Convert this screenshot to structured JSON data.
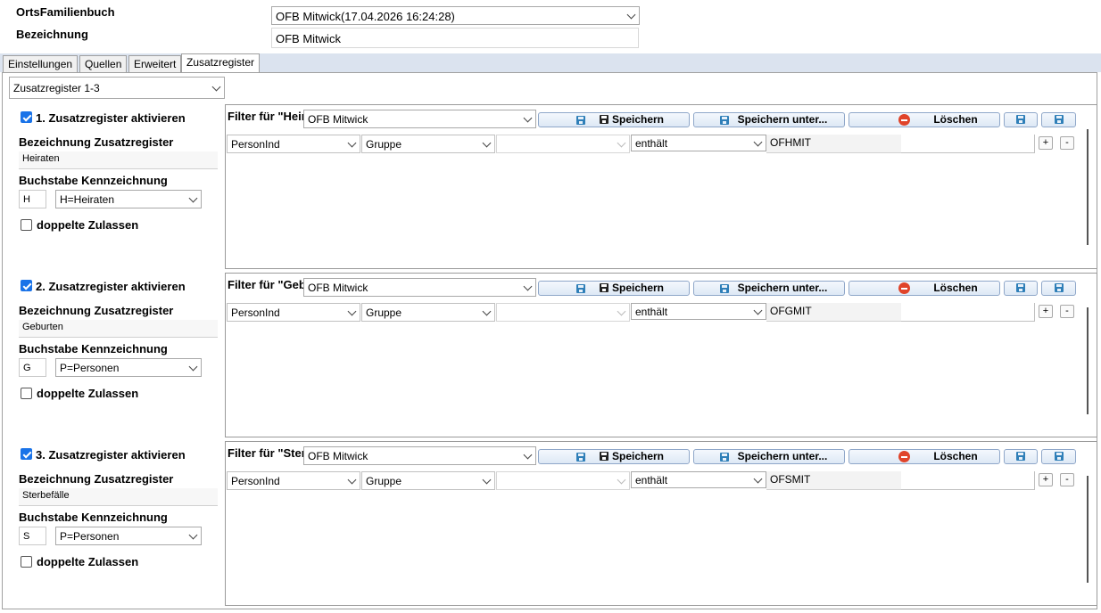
{
  "header": {
    "ofb_label": "OrtsFamilienbuch",
    "ofb_value": "OFB Mitwick(17.04.2026 16:24:28)",
    "bezeichnung_label": "Bezeichnung",
    "bezeichnung_value": "OFB Mitwick"
  },
  "tabs": [
    "Einstellungen",
    "Quellen",
    "Erweitert",
    "Zusatzregister"
  ],
  "active_tab": "Zusatzregister",
  "register_select": "Zusatzregister 1-3",
  "registers": [
    {
      "activate_label": "1. Zusatzregister aktivieren",
      "checked": true,
      "name_label": "Bezeichnung Zusatzregister",
      "name_value": "Heiraten",
      "letter_label": "Buchstabe Kennzeichnung",
      "letter_value": "H",
      "type_value": "H=Heiraten",
      "dup_label": "doppelte Zulassen",
      "dup_checked": false,
      "filter_title": "Filter für \"Heiraten\"",
      "filter_value": "OFB Mitwick",
      "btn_save": "Speichern",
      "btn_save_as": "Speichern unter...",
      "btn_delete": "Löschen",
      "cond_field": "PersonInd",
      "cond_group": "Gruppe",
      "cond_op": "enthält",
      "cond_value": "OFHMIT",
      "plus": "+",
      "minus": "-"
    },
    {
      "activate_label": "2. Zusatzregister aktivieren",
      "checked": true,
      "name_label": "Bezeichnung Zusatzregister",
      "name_value": "Geburten",
      "letter_label": "Buchstabe Kennzeichnung",
      "letter_value": "G",
      "type_value": "P=Personen",
      "dup_label": "doppelte Zulassen",
      "dup_checked": false,
      "filter_title": "Filter für \"Geburten\"",
      "filter_value": "OFB Mitwick",
      "btn_save": "Speichern",
      "btn_save_as": "Speichern unter...",
      "btn_delete": "Löschen",
      "cond_field": "PersonInd",
      "cond_group": "Gruppe",
      "cond_op": "enthält",
      "cond_value": "OFGMIT",
      "plus": "+",
      "minus": "-"
    },
    {
      "activate_label": "3. Zusatzregister aktivieren",
      "checked": true,
      "name_label": "Bezeichnung Zusatzregister",
      "name_value": "Sterbefälle",
      "letter_label": "Buchstabe Kennzeichnung",
      "letter_value": "S",
      "type_value": "P=Personen",
      "dup_label": "doppelte Zulassen",
      "dup_checked": false,
      "filter_title": "Filter für \"Sterbefälle\"",
      "filter_value": "OFB Mitwick",
      "btn_save": "Speichern",
      "btn_save_as": "Speichern unter...",
      "btn_delete": "Löschen",
      "cond_field": "PersonInd",
      "cond_group": "Gruppe",
      "cond_op": "enthält",
      "cond_value": "OFSMIT",
      "plus": "+",
      "minus": "-"
    }
  ]
}
